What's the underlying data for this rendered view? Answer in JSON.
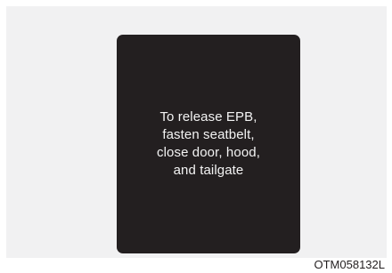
{
  "display": {
    "message": "To release EPB,\nfasten seatbelt,\nclose door, hood,\nand tailgate"
  },
  "figure": {
    "code": "OTM058132L"
  }
}
